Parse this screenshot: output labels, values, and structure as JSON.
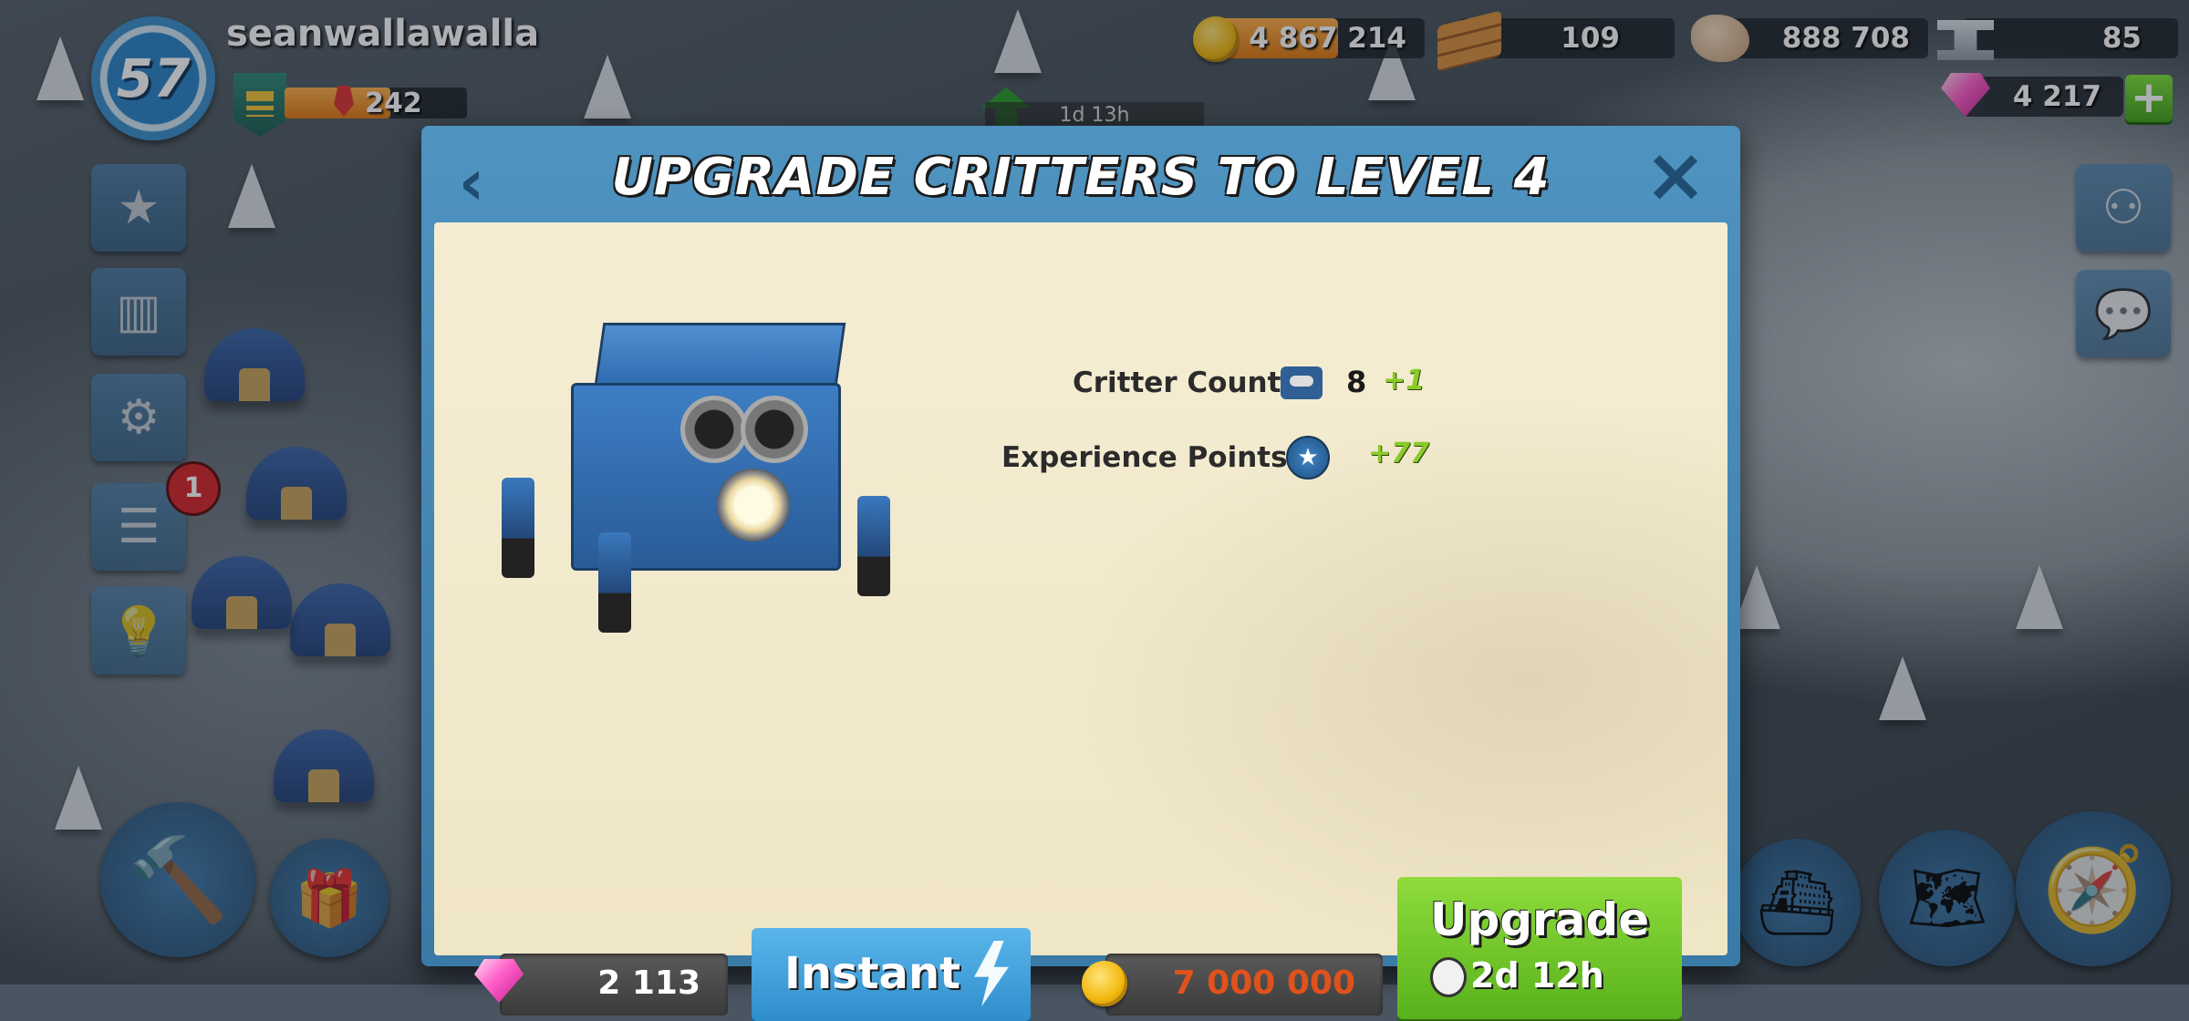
{
  "player": {
    "level": "57",
    "name": "seanwallawalla",
    "xp": "242",
    "xp_fraction": 0.58
  },
  "resources": {
    "gold": "4 867 214",
    "wood": "109",
    "stone": "888 708",
    "iron": "85",
    "diamonds": "4 217"
  },
  "map": {
    "timer": "1d 13h",
    "notification_count": "1"
  },
  "dialog": {
    "title": "UPGRADE CRITTERS TO LEVEL 4",
    "stats": {
      "critter_count_label": "Critter Count",
      "critter_count_value": "8",
      "critter_count_bonus": "+1",
      "xp_label": "Experience Points",
      "xp_bonus": "+77"
    },
    "instant_cost": "2 113",
    "instant_label": "Instant",
    "gold_cost": "7 000 000",
    "upgrade_label": "Upgrade",
    "upgrade_time": "2d 12h"
  },
  "colors": {
    "gold_cost_text": "#e0521c",
    "bonus_green": "#8acb2a",
    "accent_blue": "#3a7aa6"
  },
  "icons": [
    "gold-coin-icon",
    "wood-icon",
    "stone-icon",
    "iron-icon",
    "diamond-icon",
    "plus-icon",
    "star-icon",
    "leaderboard-icon",
    "gear-icon",
    "news-icon",
    "lightbulb-icon",
    "hammer-icon",
    "treasure-icon",
    "compass-icon",
    "map-icon",
    "boat-icon",
    "social-icon",
    "chat-icon",
    "back-arrow-icon",
    "close-icon",
    "critter-icon",
    "xp-star-icon",
    "lightning-icon",
    "stopwatch-icon"
  ]
}
